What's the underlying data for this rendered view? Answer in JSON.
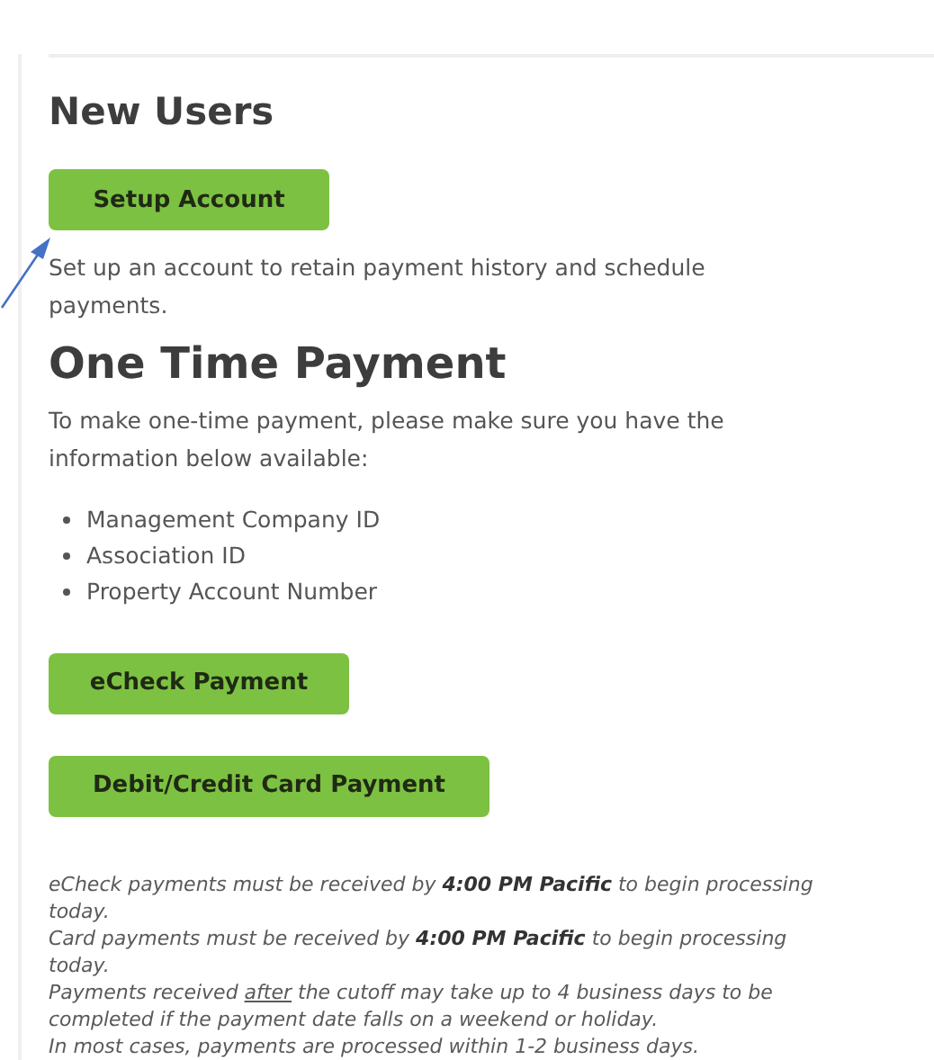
{
  "new_users": {
    "heading": "New Users",
    "button": "Setup Account",
    "description": "Set up an account to retain payment history and schedule payments."
  },
  "one_time": {
    "heading": "One Time Payment",
    "intro": "To make one-time payment, please make sure you have the information below available:",
    "items": [
      "Management Company ID",
      "Association ID",
      "Property Account Number"
    ],
    "buttons": [
      "eCheck Payment",
      "Debit/Credit Card Payment"
    ]
  },
  "notes": [
    {
      "parts": [
        {
          "kind": "plain",
          "text": "eCheck payments must be received by "
        },
        {
          "kind": "bold",
          "text": "4:00 PM Pacific"
        },
        {
          "kind": "plain",
          "text": " to begin processing today."
        }
      ]
    },
    {
      "parts": [
        {
          "kind": "plain",
          "text": "Card payments must be received by "
        },
        {
          "kind": "bold",
          "text": "4:00 PM Pacific"
        },
        {
          "kind": "plain",
          "text": " to begin processing today."
        }
      ]
    },
    {
      "parts": [
        {
          "kind": "plain",
          "text": "Payments received "
        },
        {
          "kind": "underline",
          "text": "after"
        },
        {
          "kind": "plain",
          "text": " the cutoff may take up to 4 business days to be completed if the payment date falls on a weekend or holiday."
        }
      ]
    },
    {
      "parts": [
        {
          "kind": "plain",
          "text": "In most cases, payments are processed within 1-2 business days."
        }
      ]
    }
  ]
}
